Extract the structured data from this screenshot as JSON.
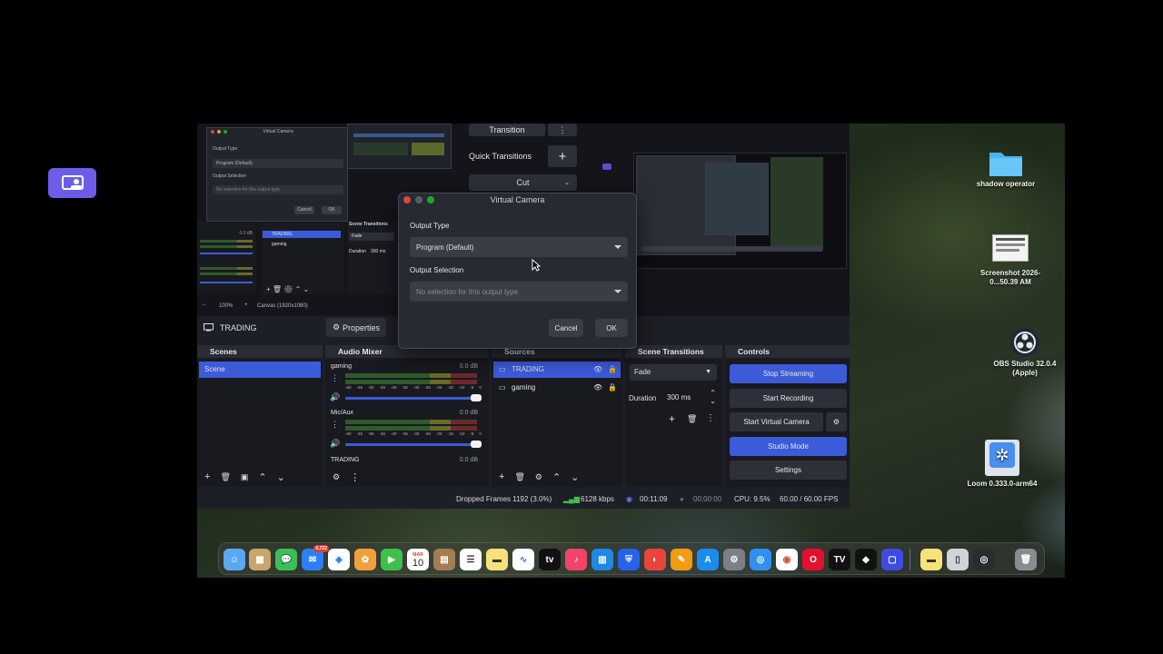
{
  "obs": {
    "current_scene_label": "TRADING",
    "properties_label": "Properties",
    "docks": {
      "scenes": {
        "title": "Scenes",
        "items": [
          "Scene"
        ]
      },
      "audio": {
        "title": "Audio Mixer",
        "channels": [
          {
            "name": "gaming",
            "db": "0.0 dB"
          },
          {
            "name": "Mic/Aux",
            "db": "0.0 dB"
          },
          {
            "name": "TRADING",
            "db": "0.0 dB"
          }
        ],
        "scale": [
          "-60",
          "-55",
          "-50",
          "-45",
          "-40",
          "-35",
          "-30",
          "-25",
          "-20",
          "-15",
          "-10",
          "-5",
          "0"
        ]
      },
      "sources": {
        "title": "Sources",
        "items": [
          "TRADING",
          "gaming"
        ]
      },
      "transitions": {
        "title": "Scene Transitions",
        "type": "Fade",
        "duration_label": "Duration",
        "duration_value": "300 ms"
      },
      "controls": {
        "title": "Controls",
        "buttons": [
          "Stop Streaming",
          "Start Recording",
          "Start Virtual Camera",
          "Studio Mode",
          "Settings"
        ]
      }
    },
    "top_panel": {
      "transition": "Transition",
      "quick_transitions": "Quick Transitions",
      "cut": "Cut"
    },
    "status": {
      "dropped": "Dropped Frames 1192 (3.0%)",
      "bitrate": "6128 kbps",
      "stream_time": "00:11:09",
      "rec_time": "00:00:00",
      "cpu": "CPU: 9.5%",
      "fps": "60.00 / 60.00 FPS"
    },
    "zoom": "100%",
    "canvas": "Canvas (1920x1080)"
  },
  "ghost_dialog": {
    "title": "Virtual Camera",
    "output_type_label": "Output Type",
    "output_type_value": "Program (Default)",
    "output_selection_label": "Output Selection",
    "output_selection_value": "No selection for this output type",
    "cancel": "Cancel",
    "ok": "OK",
    "sources": [
      "TRADING",
      "gaming"
    ],
    "transitions_title": "Scene Transitions",
    "fade": "Fade",
    "duration_label": "Duration",
    "duration_value": "300 ms",
    "meter_db": "0.0 dB"
  },
  "dialog": {
    "title": "Virtual Camera",
    "output_type_label": "Output Type",
    "output_type_value": "Program (Default)",
    "output_selection_label": "Output Selection",
    "output_selection_placeholder": "No selection for this output type",
    "cancel": "Cancel",
    "ok": "OK"
  },
  "desktop": {
    "icons": [
      {
        "label": "shadow operator"
      },
      {
        "label": "Screenshot 2026-0...50.39 AM"
      },
      {
        "label": "OBS Studio 32.0.4 (Apple)"
      },
      {
        "label": "Loom 0.333.0-arm64"
      }
    ]
  },
  "dock": {
    "mail_badge": "6,722",
    "calendar_month": "MAR",
    "calendar_day": "10"
  },
  "colors": {
    "accent": "#3c5bd9",
    "loom": "#6c5ce7"
  }
}
